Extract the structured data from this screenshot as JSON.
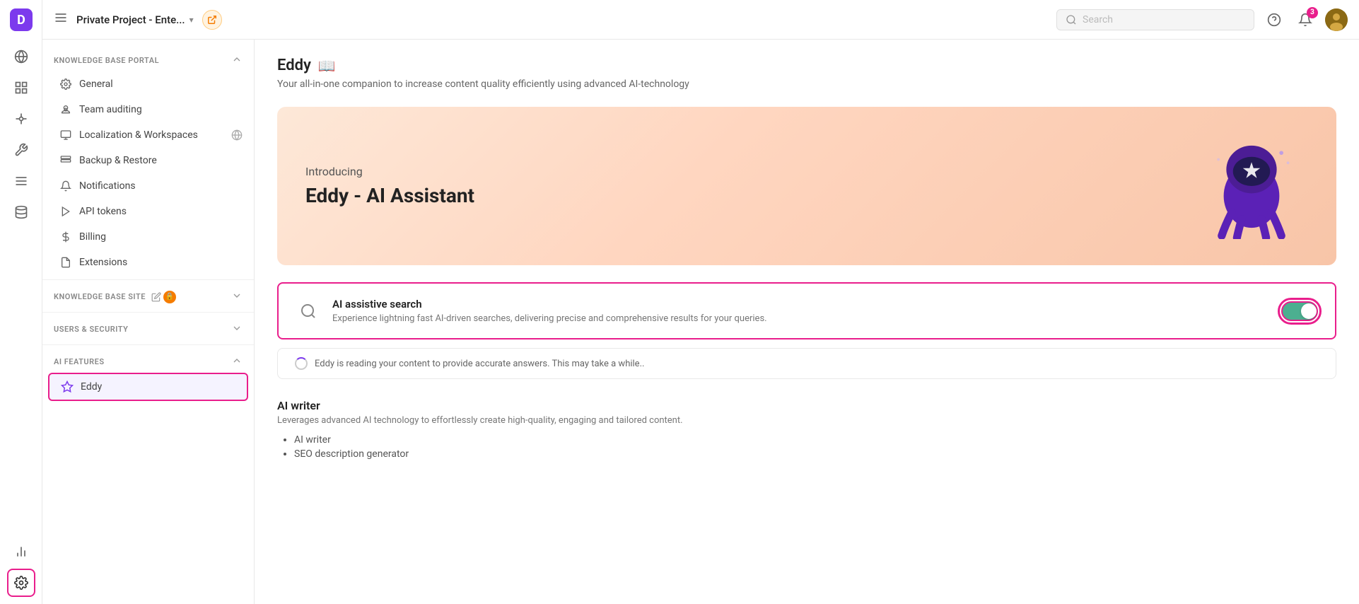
{
  "app": {
    "logo_letter": "D",
    "project_title": "Private Project - Ente...",
    "header_search_placeholder": "Search"
  },
  "nav_icons": [
    {
      "name": "globe-icon",
      "symbol": "🌐",
      "active": false
    },
    {
      "name": "dashboard-icon",
      "symbol": "▦",
      "active": false
    },
    {
      "name": "connections-icon",
      "symbol": "⊕",
      "active": false
    },
    {
      "name": "tools-icon",
      "symbol": "✕",
      "active": false
    },
    {
      "name": "list-icon",
      "symbol": "≡",
      "active": false
    },
    {
      "name": "data-icon",
      "symbol": "⊙",
      "active": false
    },
    {
      "name": "analytics-icon",
      "symbol": "↗",
      "active": false
    },
    {
      "name": "settings-icon",
      "symbol": "⚙",
      "active": true
    }
  ],
  "sidebar": {
    "sections": [
      {
        "name": "KNOWLEDGE BASE PORTAL",
        "collapsed": false,
        "items": [
          {
            "label": "General",
            "icon": "gear-icon"
          },
          {
            "label": "Team auditing",
            "icon": "audit-icon"
          },
          {
            "label": "Localization & Workspaces",
            "icon": "localization-icon"
          },
          {
            "label": "Backup & Restore",
            "icon": "backup-icon"
          },
          {
            "label": "Notifications",
            "icon": "bell-icon"
          },
          {
            "label": "API tokens",
            "icon": "api-icon"
          },
          {
            "label": "Billing",
            "icon": "billing-icon"
          },
          {
            "label": "Extensions",
            "icon": "extensions-icon"
          }
        ]
      },
      {
        "name": "KNOWLEDGE BASE SITE",
        "collapsed": true,
        "items": []
      },
      {
        "name": "USERS & SECURITY",
        "collapsed": true,
        "items": []
      },
      {
        "name": "AI FEATURES",
        "collapsed": false,
        "items": [
          {
            "label": "Eddy",
            "icon": "eddy-icon",
            "active": true
          }
        ]
      }
    ]
  },
  "main": {
    "title": "Eddy",
    "subtitle": "Your all-in-one companion to increase content quality efficiently using advanced AI-technology",
    "banner": {
      "intro": "Introducing",
      "heading": "Eddy - AI Assistant"
    },
    "features": [
      {
        "title": "AI assistive search",
        "description": "Experience lightning fast AI-driven searches, delivering precise and comprehensive results for your queries.",
        "icon": "search-icon",
        "toggle_on": true,
        "highlighted": true
      }
    ],
    "reading_status": "Eddy is reading your content to provide accurate answers. This may take a while..",
    "ai_writer": {
      "title": "AI writer",
      "description": "Leverages advanced AI technology to effortlessly create high-quality, engaging and tailored content.",
      "list_items": [
        "AI writer",
        "SEO description generator"
      ]
    }
  },
  "header": {
    "notification_count": "3",
    "search_placeholder": "Search"
  }
}
